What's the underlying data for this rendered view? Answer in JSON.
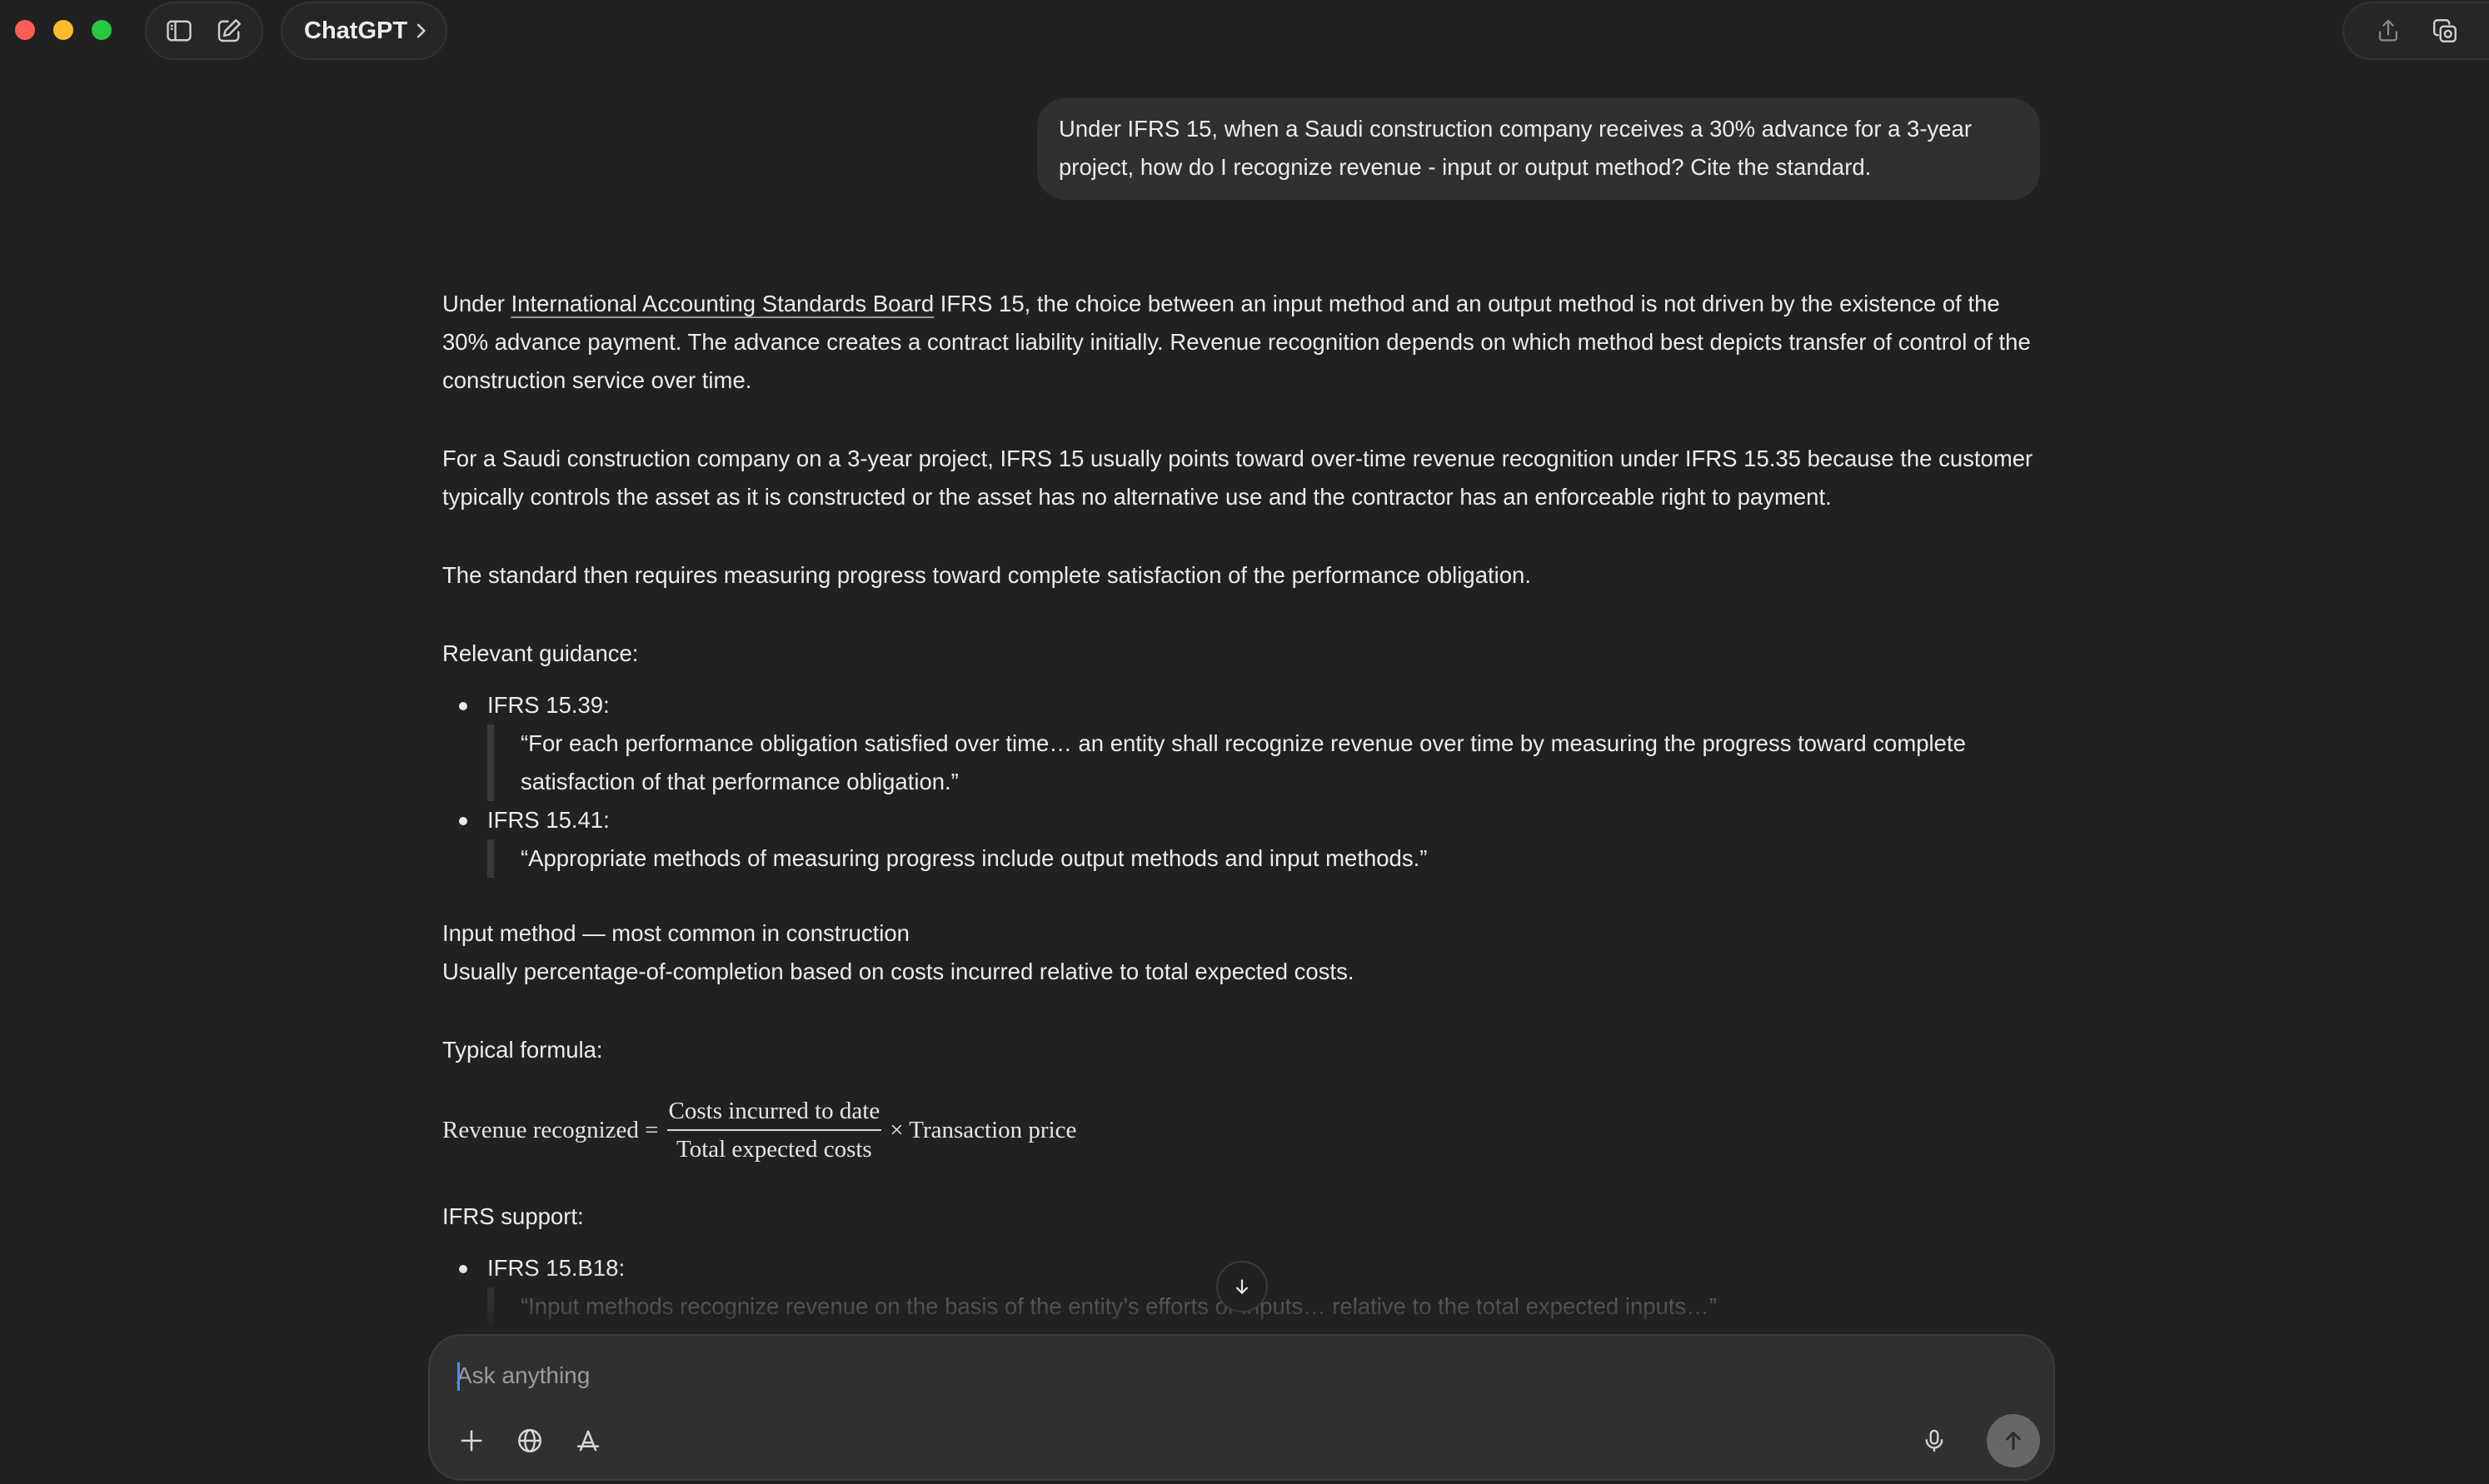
{
  "window": {
    "model_name": "ChatGPT"
  },
  "user_message": {
    "text": "Under IFRS 15, when a Saudi construction company receives a 30% advance for a 3-year project, how do I recognize revenue - input or output method? Cite the standard."
  },
  "assistant_message": {
    "p1_before_link": "Under ",
    "p1_link": "International Accounting Standards Board",
    "p1_after_link": " IFRS 15, the choice between an input method and an output method is not driven by the existence of the 30% advance payment. The advance creates a contract liability initially. Revenue recognition depends on which method best depicts transfer of control of the construction service over time.",
    "p2": "For a Saudi construction company on a 3-year project, IFRS 15 usually points toward over-time revenue recognition under IFRS 15.35 because the customer typically controls the asset as it is constructed or the asset has no alternative use and the contractor has an enforceable right to payment.",
    "p3": "The standard then requires measuring progress toward complete satisfaction of the performance obligation.",
    "guidance_heading": "Relevant guidance:",
    "guidance": [
      {
        "ref": "IFRS 15.39:",
        "quote": "“For each performance obligation satisfied over time… an entity shall recognize revenue over time by measuring the progress toward complete satisfaction of that performance obligation.”"
      },
      {
        "ref": "IFRS 15.41:",
        "quote": "“Appropriate methods of measuring progress include output methods and input methods.”"
      }
    ],
    "input_heading": "Input method — most common in construction",
    "input_text": "Usually percentage-of-completion based on costs incurred relative to total expected costs.",
    "formula_heading": "Typical formula:",
    "formula": {
      "lhs": "Revenue recognized =",
      "numerator": "Costs incurred to date",
      "denominator": "Total expected costs",
      "rhs": "× Transaction price"
    },
    "support_heading": "IFRS support:",
    "support": [
      {
        "ref": "IFRS 15.B18:",
        "quote": "“Input methods recognize revenue on the basis of the entity’s efforts or inputs… relative to the total expected inputs…”"
      }
    ]
  },
  "composer": {
    "placeholder": "Ask anything"
  },
  "icons": {
    "sidebar": "sidebar-toggle-icon",
    "new_chat": "new-chat-icon",
    "chevron": "chevron-right-icon",
    "share": "share-icon",
    "temporary": "temporary-chat-icon",
    "plus": "plus-icon",
    "globe": "globe-icon",
    "tools": "tools-icon",
    "mic": "microphone-icon",
    "send": "send-arrow-icon",
    "scroll": "arrow-down-icon"
  },
  "colors": {
    "background": "#212121",
    "bubble": "#303030",
    "text": "#ececec",
    "caret": "#4a8cff"
  }
}
